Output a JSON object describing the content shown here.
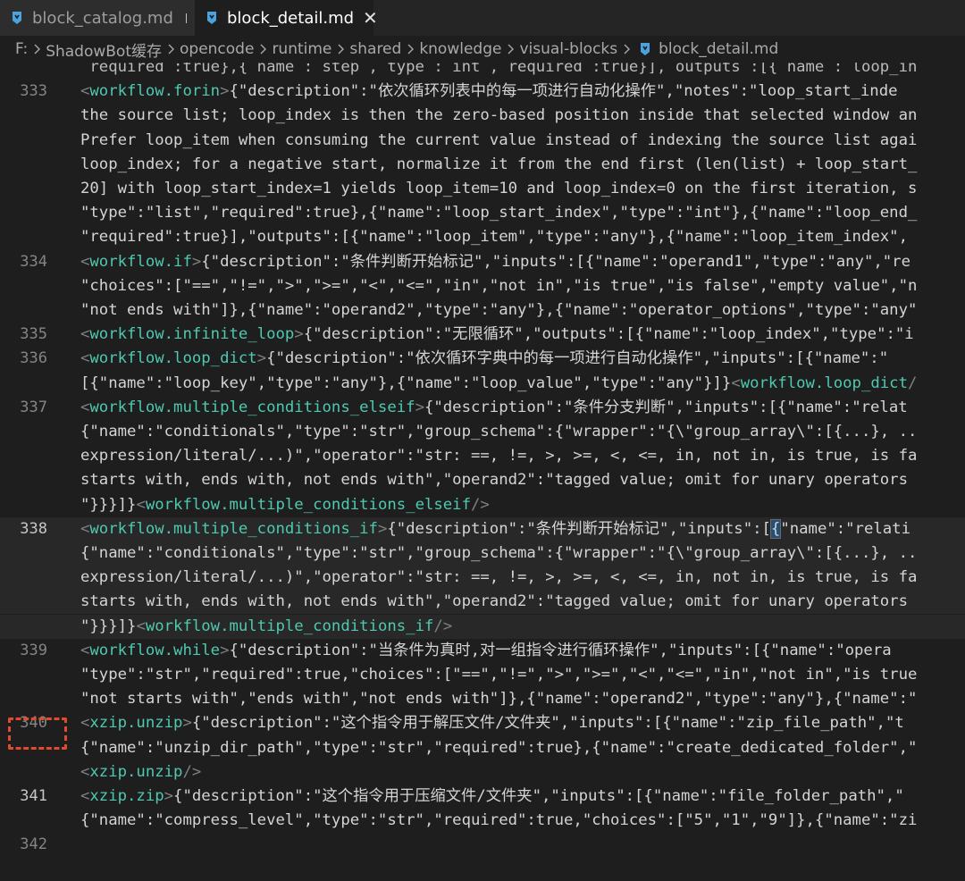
{
  "tabs": [
    {
      "label": "block_catalog.md",
      "active": false,
      "dirty": true,
      "icon": "markdown-file-icon"
    },
    {
      "label": "block_detail.md",
      "active": true,
      "dirty": false,
      "icon": "markdown-file-icon"
    }
  ],
  "breadcrumb": [
    "F:",
    "ShadowBot缓存",
    "opencode",
    "runtime",
    "shared",
    "knowledge",
    "visual-blocks",
    "block_detail.md"
  ],
  "colors": {
    "background": "#1e1e1e",
    "tag_name": "#4ec9b0",
    "punctuation": "#808080",
    "text": "#d4d4d4",
    "line_number": "#858585",
    "annotation_box": "#e04a2f"
  },
  "lines": [
    {
      "row": 0,
      "gutter": "",
      "segments": [
        {
          "t": " required :true},{ name : step , type : int , required :true}], outputs :[{ name : loop_in",
          "c": "faded"
        }
      ]
    },
    {
      "row": 1,
      "gutter": "333",
      "segments": [
        {
          "t": "<",
          "c": "tag"
        },
        {
          "t": "workflow.forin",
          "c": "tname"
        },
        {
          "t": ">",
          "c": "tag"
        },
        {
          "t": "{\"description\":\"依次循环列表中的每一项进行自动化操作\",\"notes\":\"loop_start_inde",
          "c": ""
        }
      ]
    },
    {
      "row": 2,
      "gutter": "",
      "segments": [
        {
          "t": "the source list; loop_index is then the zero-based position inside that selected window an",
          "c": ""
        }
      ]
    },
    {
      "row": 3,
      "gutter": "",
      "segments": [
        {
          "t": "Prefer loop_item when consuming the current value instead of indexing the source list agai",
          "c": ""
        }
      ]
    },
    {
      "row": 4,
      "gutter": "",
      "segments": [
        {
          "t": "loop_index; for a negative start, normalize it from the end first (len(list) + loop_start_",
          "c": ""
        }
      ]
    },
    {
      "row": 5,
      "gutter": "",
      "segments": [
        {
          "t": "20] with loop_start_index=1 yields loop_item=10 and loop_index=0 on the first iteration, s",
          "c": ""
        }
      ]
    },
    {
      "row": 6,
      "gutter": "",
      "segments": [
        {
          "t": "\"type\":\"list\",\"required\":true},{\"name\":\"loop_start_index\",\"type\":\"int\"},{\"name\":\"loop_end_",
          "c": ""
        }
      ]
    },
    {
      "row": 7,
      "gutter": "",
      "segments": [
        {
          "t": "\"required\":true}],\"outputs\":[{\"name\":\"loop_item\",\"type\":\"any\"},{\"name\":\"loop_item_index\",",
          "c": ""
        }
      ]
    },
    {
      "row": 8,
      "gutter": "334",
      "segments": [
        {
          "t": "<",
          "c": "tag"
        },
        {
          "t": "workflow.if",
          "c": "tname"
        },
        {
          "t": ">",
          "c": "tag"
        },
        {
          "t": "{\"description\":\"条件判断开始标记\",\"inputs\":[{\"name\":\"operand1\",\"type\":\"any\",\"re",
          "c": ""
        }
      ]
    },
    {
      "row": 9,
      "gutter": "",
      "segments": [
        {
          "t": "\"choices\":[\"==\",\"!=\",\">\",\">=\",\"<\",\"<=\",\"in\",\"not in\",\"is true\",\"is false\",\"empty value\",\"n",
          "c": ""
        }
      ]
    },
    {
      "row": 10,
      "gutter": "",
      "segments": [
        {
          "t": "\"not ends with\"]},{\"name\":\"operand2\",\"type\":\"any\"},{\"name\":\"operator_options\",\"type\":\"any\"",
          "c": ""
        }
      ]
    },
    {
      "row": 11,
      "gutter": "335",
      "segments": [
        {
          "t": "<",
          "c": "tag"
        },
        {
          "t": "workflow.infinite_loop",
          "c": "tname"
        },
        {
          "t": ">",
          "c": "tag"
        },
        {
          "t": "{\"description\":\"无限循环\",\"outputs\":[{\"name\":\"loop_index\",\"type\":\"i",
          "c": ""
        }
      ]
    },
    {
      "row": 12,
      "gutter": "336",
      "segments": [
        {
          "t": "<",
          "c": "tag"
        },
        {
          "t": "workflow.loop_dict",
          "c": "tname"
        },
        {
          "t": ">",
          "c": "tag"
        },
        {
          "t": "{\"description\":\"依次循环字典中的每一项进行自动化操作\",\"inputs\":[{\"name\":\"",
          "c": ""
        }
      ]
    },
    {
      "row": 13,
      "gutter": "",
      "segments": [
        {
          "t": "[{\"name\":\"loop_key\",\"type\":\"any\"},{\"name\":\"loop_value\",\"type\":\"any\"}]}",
          "c": ""
        },
        {
          "t": "<",
          "c": "tag"
        },
        {
          "t": "workflow.loop_dict",
          "c": "tname"
        },
        {
          "t": "/",
          "c": "tag"
        }
      ]
    },
    {
      "row": 14,
      "gutter": "337",
      "segments": [
        {
          "t": "<",
          "c": "tag"
        },
        {
          "t": "workflow.multiple_conditions_elseif",
          "c": "tname"
        },
        {
          "t": ">",
          "c": "tag"
        },
        {
          "t": "{\"description\":\"条件分支判断\",\"inputs\":[{\"name\":\"relat",
          "c": ""
        }
      ]
    },
    {
      "row": 15,
      "gutter": "",
      "segments": [
        {
          "t": "{\"name\":\"conditionals\",\"type\":\"str\",\"group_schema\":{\"wrapper\":\"{\\\"group_array\\\":[{...}, ..",
          "c": ""
        }
      ]
    },
    {
      "row": 16,
      "gutter": "",
      "segments": [
        {
          "t": "expression/literal/...)\",\"operator\":\"str: ==, !=, >, >=, <, <=, in, not in, is true, is fa",
          "c": ""
        }
      ]
    },
    {
      "row": 17,
      "gutter": "",
      "segments": [
        {
          "t": "starts with, ends with, not ends with\",\"operand2\":\"tagged value; omit for unary operators",
          "c": ""
        }
      ]
    },
    {
      "row": 18,
      "gutter": "",
      "segments": [
        {
          "t": "\"}}}]}",
          "c": ""
        },
        {
          "t": "<",
          "c": "tag"
        },
        {
          "t": "workflow.multiple_conditions_elseif",
          "c": "tname"
        },
        {
          "t": "/>",
          "c": "tag"
        }
      ]
    },
    {
      "row": 19,
      "gutter": "338",
      "current": true,
      "highlight": true,
      "segments": [
        {
          "t": "<",
          "c": "tag"
        },
        {
          "t": "workflow.multiple_conditions_if",
          "c": "tname"
        },
        {
          "t": ">",
          "c": "tag"
        },
        {
          "t": "{\"description\":\"条件判断开始标记\",\"inputs\":[",
          "c": ""
        },
        {
          "t": "{",
          "c": "cursorbox"
        },
        {
          "t": "\"name\":\"relati",
          "c": ""
        }
      ]
    },
    {
      "row": 20,
      "gutter": "",
      "highlight": true,
      "segments": [
        {
          "t": "{\"name\":\"conditionals\",\"type\":\"str\",\"group_schema\":{\"wrapper\":\"{\\\"group_array\\\":[{...}, ..",
          "c": ""
        }
      ]
    },
    {
      "row": 21,
      "gutter": "",
      "highlight": true,
      "segments": [
        {
          "t": "expression/literal/...)\",\"operator\":\"str: ==, !=, >, >=, <, <=, in, not in, is true, is fa",
          "c": ""
        }
      ]
    },
    {
      "row": 22,
      "gutter": "",
      "highlight": true,
      "segments": [
        {
          "t": "starts with, ends with, not ends with\",\"operand2\":\"tagged value; omit for unary operators",
          "c": ""
        }
      ]
    },
    {
      "row": 23,
      "gutter": "",
      "highlight": true,
      "segments": [
        {
          "t": "\"}}}]}",
          "c": ""
        },
        {
          "t": "<",
          "c": "tag"
        },
        {
          "t": "workflow.multiple_conditions_if",
          "c": "tname"
        },
        {
          "t": "/>",
          "c": "tag"
        }
      ]
    },
    {
      "row": 24,
      "gutter": "339",
      "segments": [
        {
          "t": "<",
          "c": "tag"
        },
        {
          "t": "workflow.while",
          "c": "tname"
        },
        {
          "t": ">",
          "c": "tag"
        },
        {
          "t": "{\"description\":\"当条件为真时,对一组指令进行循环操作\",\"inputs\":[{\"name\":\"opera",
          "c": ""
        }
      ]
    },
    {
      "row": 25,
      "gutter": "",
      "segments": [
        {
          "t": "\"type\":\"str\",\"required\":true,\"choices\":[\"==\",\"!=\",\">\",\">=\",\"<\",\"<=\",\"in\",\"not in\",\"is true",
          "c": ""
        }
      ]
    },
    {
      "row": 26,
      "gutter": "",
      "segments": [
        {
          "t": "\"not starts with\",\"ends with\",\"not ends with\"]},{\"name\":\"operand2\",\"type\":\"any\"},{\"name\":\"",
          "c": ""
        }
      ]
    },
    {
      "row": 27,
      "gutter": "340",
      "segments": [
        {
          "t": "<",
          "c": "tag"
        },
        {
          "t": "xzip.unzip",
          "c": "tname"
        },
        {
          "t": ">",
          "c": "tag"
        },
        {
          "t": "{\"description\":\"这个指令用于解压文件/文件夹\",\"inputs\":[{\"name\":\"zip_file_path\",\"t",
          "c": ""
        }
      ]
    },
    {
      "row": 28,
      "gutter": "",
      "segments": [
        {
          "t": "{\"name\":\"unzip_dir_path\",\"type\":\"str\",\"required\":true},{\"name\":\"create_dedicated_folder\",\"",
          "c": ""
        }
      ]
    },
    {
      "row": 29,
      "gutter": "",
      "segments": [
        {
          "t": "<",
          "c": "tag"
        },
        {
          "t": "xzip.unzip",
          "c": "tname"
        },
        {
          "t": "/>",
          "c": "tag"
        }
      ]
    },
    {
      "row": 30,
      "gutter": "341",
      "current": true,
      "segments": [
        {
          "t": "<",
          "c": "tag"
        },
        {
          "t": "xzip.zip",
          "c": "tname"
        },
        {
          "t": ">",
          "c": "tag"
        },
        {
          "t": "{\"description\":\"这个指令用于压缩文件/文件夹\",\"inputs\":[{\"name\":\"file_folder_path\",\"",
          "c": ""
        }
      ]
    },
    {
      "row": 31,
      "gutter": "",
      "segments": [
        {
          "t": "{\"name\":\"compress_level\",\"type\":\"str\",\"required\":true,\"choices\":[\"5\",\"1\",\"9\"]},{\"name\":\"zi",
          "c": ""
        }
      ]
    },
    {
      "row": 32,
      "gutter": "342",
      "segments": []
    }
  ]
}
